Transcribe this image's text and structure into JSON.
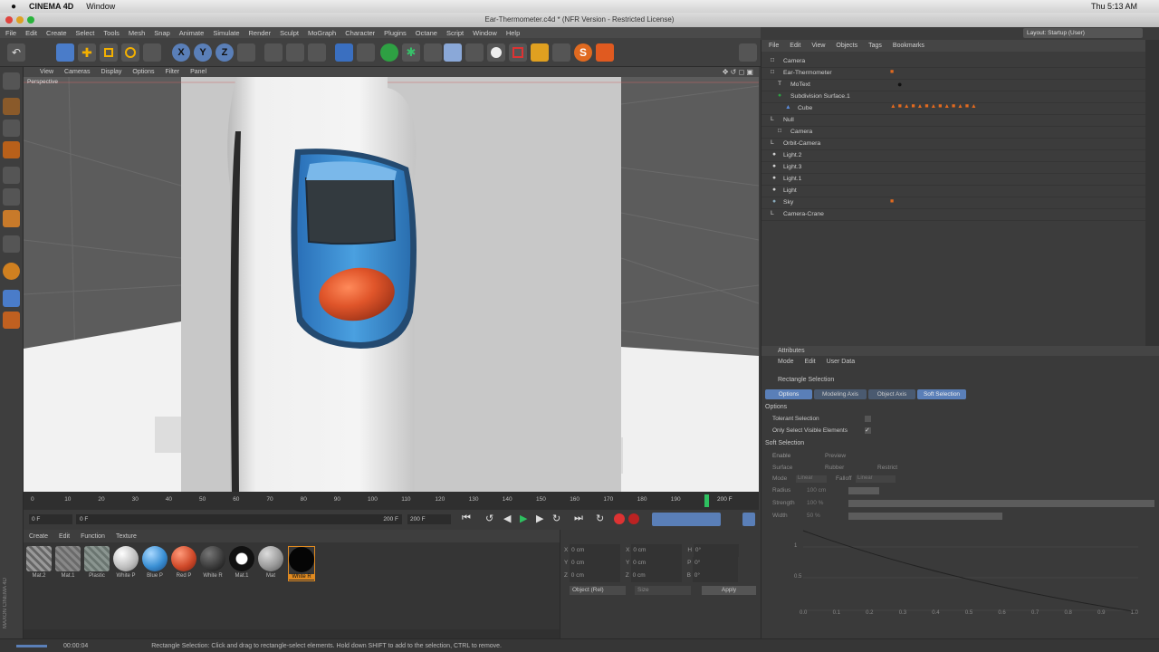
{
  "mac_menu": {
    "app": "CINEMA 4D",
    "window": "Window",
    "clock": "Thu 5:13 AM"
  },
  "window_title": "Ear-Thermometer.c4d * (NFR Version - Restricted License)",
  "menubar": [
    "File",
    "Edit",
    "Create",
    "Select",
    "Tools",
    "Mesh",
    "Snap",
    "Animate",
    "Simulate",
    "Render",
    "Sculpt",
    "MoGraph",
    "Character",
    "Plugins",
    "Octane",
    "Script",
    "Window",
    "Help"
  ],
  "viewport": {
    "menu": [
      "View",
      "Cameras",
      "Display",
      "Options",
      "Filter",
      "Panel"
    ],
    "label": "Perspective"
  },
  "timeline": {
    "ticks": [
      "0",
      "10",
      "20",
      "30",
      "40",
      "50",
      "60",
      "70",
      "80",
      "90",
      "100",
      "110",
      "120",
      "130",
      "140",
      "150",
      "160",
      "170",
      "180",
      "190"
    ],
    "end_label": "200 F",
    "current_frame": "0 F",
    "start_field": "0 F",
    "end_field": "200 F",
    "end_field2": "200 F"
  },
  "material_manager": {
    "menu": [
      "Create",
      "Edit",
      "Function",
      "Texture"
    ],
    "materials": [
      {
        "label": "Mat.2",
        "color": "#888"
      },
      {
        "label": "Mat.1",
        "color": "#7a7a7a"
      },
      {
        "label": "Plastic",
        "color": "#8a9590"
      },
      {
        "label": "White P",
        "color": "#e8e8e8"
      },
      {
        "label": "Blue P",
        "color": "#3a8fd4"
      },
      {
        "label": "Red P",
        "color": "#d04a2a"
      },
      {
        "label": "White R",
        "color": "#3c3c3c"
      },
      {
        "label": "Mat.1",
        "color": "#1a1a1a"
      },
      {
        "label": "Mat",
        "color": "#9a9a9a"
      },
      {
        "label": "White R",
        "color": "#050505"
      }
    ]
  },
  "coordinates": {
    "rows": [
      {
        "axis": "X",
        "v1": "0 cm",
        "l2": "X",
        "v2": "0 cm",
        "l3": "H",
        "v3": "0°"
      },
      {
        "axis": "Y",
        "v1": "0 cm",
        "l2": "Y",
        "v2": "0 cm",
        "l3": "P",
        "v3": "0°"
      },
      {
        "axis": "Z",
        "v1": "0 cm",
        "l2": "Z",
        "v2": "0 cm",
        "l3": "B",
        "v3": "0°"
      }
    ],
    "mode": "Object (Rel)",
    "size_mode": "Size",
    "apply": "Apply"
  },
  "object_manager": {
    "menu": [
      "File",
      "Edit",
      "View",
      "Objects",
      "Tags",
      "Bookmarks"
    ],
    "objects": [
      {
        "name": "Camera",
        "indent": 0
      },
      {
        "name": "Ear-Thermometer",
        "indent": 0
      },
      {
        "name": "MoText",
        "indent": 1
      },
      {
        "name": "Subdivision Surface.1",
        "indent": 1
      },
      {
        "name": "Cube",
        "indent": 2
      },
      {
        "name": "Null",
        "indent": 0
      },
      {
        "name": "Camera",
        "indent": 1
      },
      {
        "name": "Orbit-Camera",
        "indent": 0
      },
      {
        "name": "Light.2",
        "indent": 0
      },
      {
        "name": "Light.3",
        "indent": 0
      },
      {
        "name": "Light.1",
        "indent": 0
      },
      {
        "name": "Light",
        "indent": 0
      },
      {
        "name": "Sky",
        "indent": 0
      },
      {
        "name": "Camera-Crane",
        "indent": 0
      }
    ]
  },
  "attributes": {
    "title": "Attributes",
    "menu": [
      "Mode",
      "Edit",
      "User Data"
    ],
    "tool_name": "Rectangle Selection",
    "tabs": [
      "Options",
      "Modeling Axis",
      "Object Axis",
      "Soft Selection"
    ],
    "options_header": "Options",
    "tolerant_label": "Tolerant Selection",
    "only_visible_label": "Only Select Visible Elements",
    "soft_header": "Soft Selection",
    "enable_label": "Enable",
    "preview_label": "Preview",
    "surface_label": "Surface",
    "rubber_label": "Rubber",
    "restrict_label": "Restrict",
    "mode_label": "Mode",
    "mode_value": "Linear",
    "falloff_label": "Falloff",
    "falloff_value": "Linear",
    "radius_label": "Radius",
    "radius_value": "100 cm",
    "strength_label": "Strength",
    "strength_value": "100 %",
    "width_label": "Width",
    "width_value": "50 %",
    "graph_y": [
      "1",
      "0.5"
    ],
    "graph_x": [
      "0.0",
      "0.1",
      "0.2",
      "0.3",
      "0.4",
      "0.5",
      "0.6",
      "0.7",
      "0.8",
      "0.9",
      "1.0"
    ]
  },
  "statusbar": {
    "time": "00:00:04",
    "message": "Rectangle Selection: Click and drag to rectangle-select elements. Hold down SHIFT to add to the selection, CTRL to remove."
  },
  "layout_label": "Layout: Startup (User)",
  "colors": {
    "accent_blue": "#5a7fb8",
    "thermo_blue": "#3a8fd4",
    "button_red": "#e0552a"
  }
}
